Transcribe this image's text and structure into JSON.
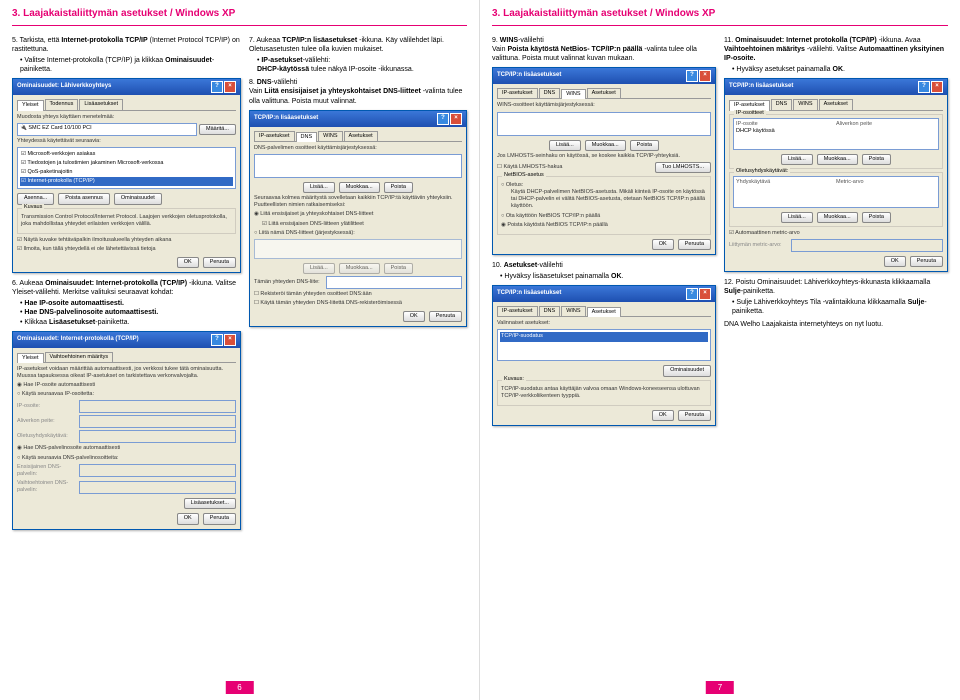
{
  "left": {
    "header": "3. Laajakaistaliittymän asetukset / Windows XP",
    "step5": {
      "num": "5.",
      "text": "Tarkista, että",
      "bold": "Internet-protokolla TCP/IP",
      "text2": "(Internet Protocol TCP/IP) on rastitettuna.",
      "bul1": "Valitse Internet-protokolla (TCP/IP) ja klikkaa",
      "bul1b": "Ominaisuudet",
      "bul1c": "-painiketta."
    },
    "win_lahi": {
      "title": "Ominaisuudet: Lähiverkkoyhteys",
      "tab1": "Yleiset",
      "tab2": "Todennus",
      "tab3": "Lisäasetukset",
      "connectUsing": "Muodosta yhteys käyttäen menetelmää:",
      "adapter": "SMC EZ Card 10/100 PCI",
      "configure": "Määritä...",
      "usesItems": "Yhteydessä käytettävät seuraavia:",
      "i1": "Microsoft-verkkojen asiakas",
      "i2": "Tiedostojen ja tulostimien jakaminen Microsoft-verkossa",
      "i3": "QoS-paketinajoitin",
      "i4": "Internet-protokolla (TCP/IP)",
      "install": "Asenna...",
      "uninstall": "Poista asennus",
      "props": "Ominaisuudet",
      "descTitle": "Kuvaus",
      "desc": "Transmission Control Protocol/Internet Protocol. Laajojen verkkojen oletusprotokolla, joka mahdollistaa yhteydet erilaisten verkkojen välillä.",
      "c1": "Näytä kuvake tehtäväpalkin ilmoitusalueella yhteyden aikana",
      "c2": "Ilmoita, kun tällä yhteydellä ei ole lähetettävissä tietoja",
      "ok": "OK",
      "cancel": "Peruuta"
    },
    "step7": {
      "num": "7.",
      "t1": "Aukeaa",
      "b1": "TCP/IP:n lisäasetukset",
      "t2": "-ikkuna. Käy välilehdet läpi. Oletusasetusten tulee olla kuvien mukaiset.",
      "bul1b": "IP-asetukset",
      "bul1t": "-välilehti:",
      "bul1ind": "DHCP-käytössä",
      "bul1ind2": "tulee näkyä IP-osoite -ikkunassa."
    },
    "step8": {
      "num": "8.",
      "b1": "DNS",
      "t1": "-välilehti",
      "line2a": "Vain",
      "line2b": "Liitä ensisijaiset ja yhteyskohtaiset DNS-liitteet",
      "line2c": "-valinta tulee olla valittuna. Poista muut valinnat."
    },
    "win_dns": {
      "title": "TCP/IP:n lisäasetukset",
      "tab1": "IP-asetukset",
      "tab2": "DNS",
      "tab3": "WINS",
      "tab4": "Asetukset",
      "dnshdr": "DNS-palvelimen osoitteet käyttämisjärjestyksessä:",
      "add": "Lisää...",
      "edit": "Muokkaa...",
      "remove": "Poista",
      "desc2": "Seuraavaa kolmea määritystä sovelletaan kaikkiin TCP/IP:tä käyttäviin yhteyksiin. Puutteellisten nimien ratkaisemiseksi:",
      "r1": "Liitä ensisijaiset ja yhteyskohtaiset DNS-liitteet",
      "c1": "Liitä ensisijaisen DNS-liitteen ylätilitteet",
      "r2": "Liitä nämä DNS-liitteet (järjestyksessä):",
      "suffix": "Tämän yhteyden DNS-liite:",
      "c2": "Rekisteröi tämän yhteyden osoitteet DNS:ään",
      "c3": "Käytä tämän yhteyden DNS-liitettä DNS-rekisteröimisessä",
      "ok": "OK",
      "cancel": "Peruuta"
    },
    "step6": {
      "num": "6.",
      "t1": "Aukeaa",
      "b1": "Ominaisuudet: Internet-protokolla (TCP/IP)",
      "t2": "-ikkuna. Valitse Yleiset-välilehti. Merkitse valituksi seuraavat kohdat:",
      "bul1": "Hae IP-osoite automaattisesti.",
      "bul2": "Hae DNS-palvelinosoite automaattisesti.",
      "bul3a": "Klikkaa",
      "bul3b": "Lisäasetukset",
      "bul3c": "-painiketta."
    },
    "win_ip": {
      "title": "Ominaisuudet: Internet-protokolla (TCP/IP)",
      "tab1": "Yleiset",
      "tab2": "Vaihtoehtoinen määritys",
      "desc": "IP-asetukset voidaan määrittää automaattisesti, jos verkkosi tukee tätä ominaisuutta. Muussa tapauksessa oikeat IP-asetukset on tarkistettava verkonvalvojalta.",
      "r1": "Hae IP-osoite automaattisesti",
      "r2": "Käytä seuraavaa IP-osoitetta:",
      "f1": "IP-osoite:",
      "f2": "Aliverkon peite:",
      "f3": "Oletusyhdyskäytävä:",
      "r3": "Hae DNS-palvelinosoite automaattisesti",
      "r4": "Käytä seuraavia DNS-palvelinosoitteita:",
      "f4": "Ensisijainen DNS-palvelin:",
      "f5": "Vaihtoehtoinen DNS-palvelin:",
      "adv": "Lisäasetukset...",
      "ok": "OK",
      "cancel": "Peruuta"
    },
    "pagenum": "6"
  },
  "right": {
    "header": "3. Laajakaistaliittymän asetukset / Windows XP",
    "step9": {
      "num": "9.",
      "b1": "WINS",
      "t1": "-välilehti",
      "l2a": "Vain",
      "l2b": "Poista käytöstä NetBios- TCP/IP:n päällä",
      "l2c": "-valinta tulee olla valittuna. Poista muut valinnat kuvan mukaan."
    },
    "win_wins": {
      "title": "TCP/IP:n lisäasetukset",
      "tab1": "IP-asetukset",
      "tab2": "DNS",
      "tab3": "WINS",
      "tab4": "Asetukset",
      "hdr": "WINS-osoitteet käyttämisjärjestyksessä:",
      "add": "Lisää...",
      "edit": "Muokkaa...",
      "remove": "Poista",
      "desc": "Jos LMHOSTS-seinhaku on käytössä, se koskee kaikkia TCP/IP-yhteyksiä.",
      "c1": "Käytä LMHOSTS-hakua",
      "import": "Tuo LMHOSTS...",
      "grp": "NetBIOS-asetus",
      "r1": "Oletus:",
      "r1d": "Käytä DHCP-palvelimen NetBIOS-asetusta. Mikäli kiinteä IP-osoite on käytössä tai DHCP-palvelin ei välitä NetBIOS-asetusta, otetaan NetBIOS TCP/IP:n päällä käyttöön.",
      "r2": "Ota käyttöön NetBIOS TCP/IP:n päällä",
      "r3": "Poista käytöstä NetBIOS TCP/IP:n päällä",
      "ok": "OK",
      "cancel": "Peruuta"
    },
    "step11": {
      "num": "11.",
      "b1": "Ominaisuudet: Internet protokolla (TCP/IP)",
      "t1": "-ikkuna. Avaa",
      "b2": "Vaihtoehtoinen määritys",
      "t2": "-välilehti. Valitse",
      "b3": "Automaattinen yksityinen IP-osoite.",
      "bul1a": "Hyväksy asetukset painamalla",
      "bul1b": "OK"
    },
    "win_alt": {
      "title": "TCP/IP:n lisäasetukset",
      "tab1": "IP-asetukset",
      "tab2": "DNS",
      "tab3": "WINS",
      "tab4": "Asetukset",
      "hdr": "IP-osoitteet",
      "col1": "IP-osoite",
      "col2": "Aliverkon peite",
      "val": "DHCP käytössä",
      "add": "Lisää...",
      "edit": "Muokkaa...",
      "remove": "Poista",
      "grp2": "Oletusyhdyskäytävät:",
      "col3": "Yhdyskäytävä",
      "col4": "Metric-arvo",
      "c1": "Automaattinen metric-arvo",
      "f1": "Liittymän metric-arvo:",
      "ok": "OK",
      "cancel": "Peruuta"
    },
    "step10": {
      "num": "10.",
      "b1": "Asetukset",
      "t1": "-välilehti",
      "bul1a": "Hyväksy lisäasetukset painamalla",
      "bul1b": "OK"
    },
    "win_opt": {
      "title": "TCP/IP:n lisäasetukset",
      "tab1": "IP-asetukset",
      "tab2": "DNS",
      "tab3": "WINS",
      "tab4": "Asetukset",
      "hdr": "Valinnaiset asetukset:",
      "item": "TCP/IP-suodatus",
      "props": "Ominaisuudet",
      "grp": "Kuvaus:",
      "desc": "TCP/IP-suodatus antaa käyttäjän valvoa omaan Windows-koneeseensa ulottuvan TCP/IP-verkkoliikenteen tyyppiä.",
      "ok": "OK",
      "cancel": "Peruuta"
    },
    "step12": {
      "num": "12.",
      "t1": "Poistu Ominaisuudet: Lähiverkkoyhteys-ikkunasta klikkaamalla",
      "b1": "Sulje",
      "t1b": "-painiketta.",
      "bul1a": "Sulje Lähiverkkoyhteys Tila -valintaikkuna klikkaamalla",
      "bul1b": "Sulje",
      "bul1c": "-painiketta.",
      "final": "DNA Welho Laajakaista internetyhteys on nyt luotu."
    },
    "pagenum": "7"
  }
}
